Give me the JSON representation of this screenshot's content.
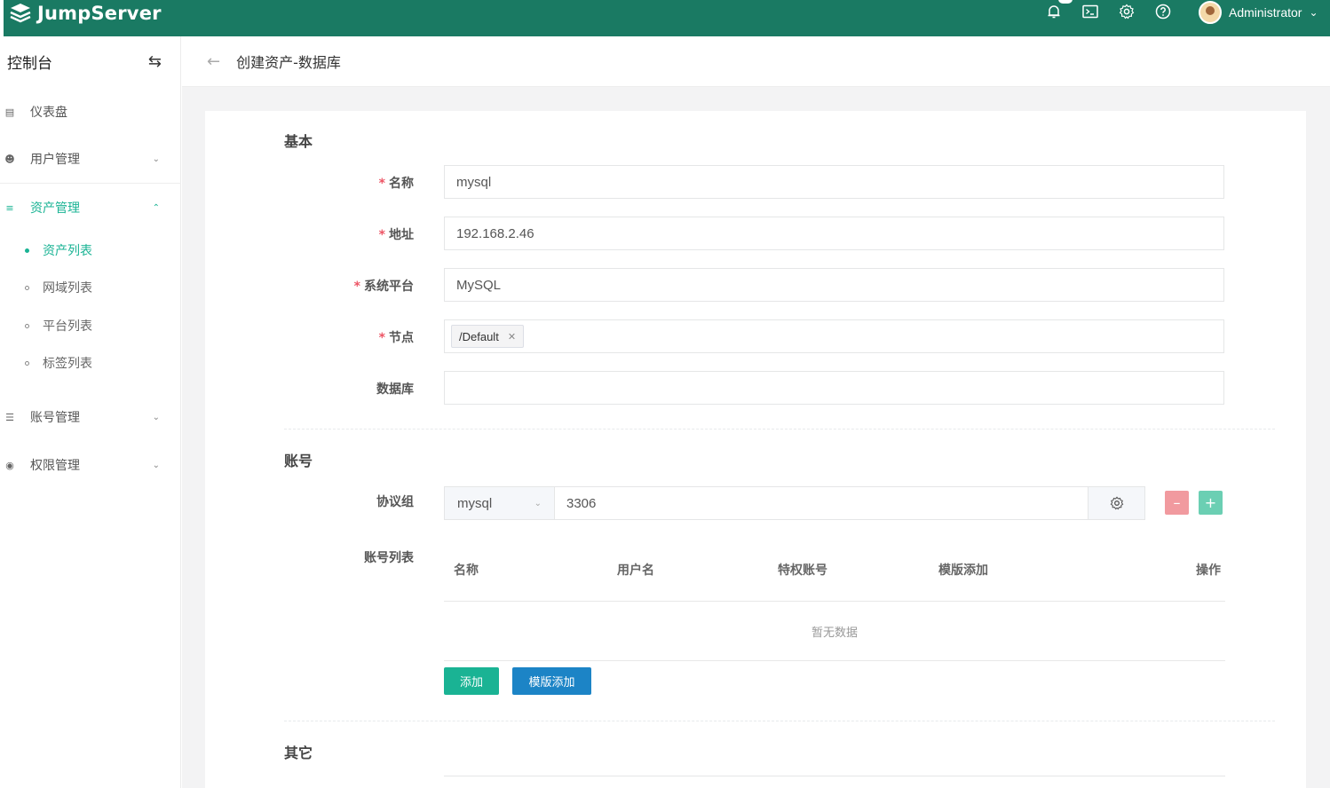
{
  "app": {
    "name": "JumpServer"
  },
  "topbar": {
    "icons": [
      "bell-icon",
      "terminal-icon",
      "gear-icon",
      "help-icon"
    ],
    "user": {
      "name": "Administrator"
    }
  },
  "sidebar": {
    "title": "控制台",
    "menu": {
      "dashboard": "仪表盘",
      "users": "用户管理",
      "assets": "资产管理",
      "accounts": "账号管理",
      "perms": "权限管理"
    },
    "asset_sub": [
      "资产列表",
      "网域列表",
      "平台列表",
      "标签列表"
    ]
  },
  "page": {
    "title": "创建资产-数据库"
  },
  "form": {
    "basic": {
      "section": "基本",
      "name_label": "名称",
      "name_value": "mysql",
      "address_label": "地址",
      "address_value": "192.168.2.46",
      "platform_label": "系统平台",
      "platform_value": "MySQL",
      "node_label": "节点",
      "node_tag": "/Default",
      "db_label": "数据库",
      "db_value": ""
    },
    "account": {
      "section": "账号",
      "protocol_label": "协议组",
      "protocol_name": "mysql",
      "protocol_port": "3306",
      "list_label": "账号列表",
      "columns": [
        "名称",
        "用户名",
        "特权账号",
        "模版添加",
        "操作"
      ],
      "empty": "暂无数据",
      "add_label": "添加",
      "template_add_label": "模版添加"
    },
    "other": {
      "section": "其它"
    }
  },
  "colors": {
    "brand": "#1a7a63",
    "accent": "#1ab394",
    "primary": "#1c84c6",
    "danger": "#ed5565"
  }
}
